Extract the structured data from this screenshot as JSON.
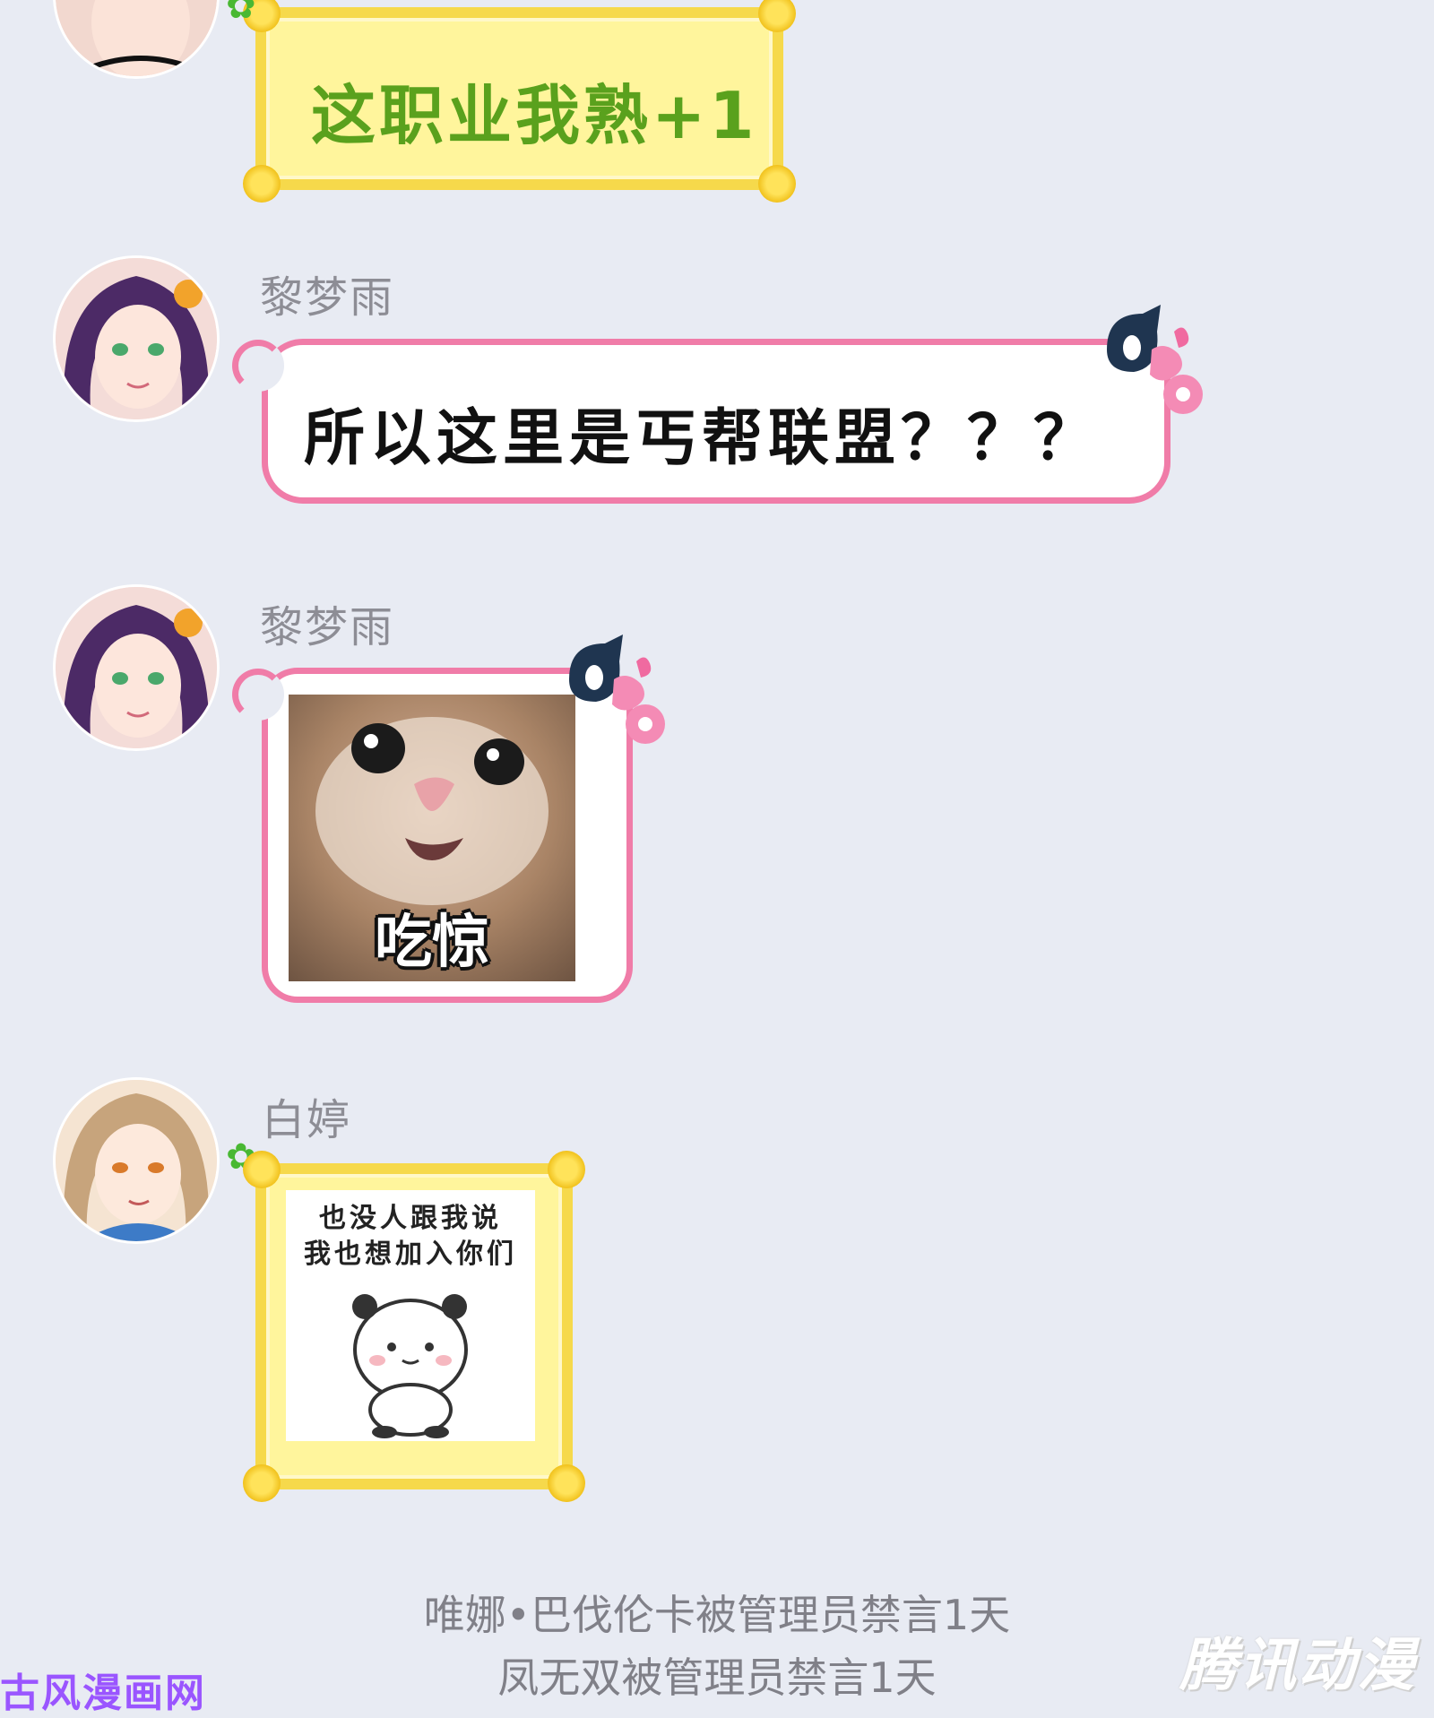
{
  "messages": [
    {
      "sender": "",
      "text": "这职业我熟+1"
    },
    {
      "sender": "黎梦雨",
      "text": "所以这里是丐帮联盟？？？"
    },
    {
      "sender": "黎梦雨",
      "sticker_caption": "吃惊"
    },
    {
      "sender": "白婷",
      "sticker_lines": [
        "也没人跟我说",
        "我也想加入你们"
      ]
    }
  ],
  "system_notices": [
    "唯娜•巴伐伦卡被管理员禁言1天",
    "凤无双被管理员禁言1天"
  ],
  "watermarks": {
    "left": "古风漫画网",
    "right": "腾讯动漫"
  },
  "colors": {
    "background": "#e8ebf3",
    "pink_border": "#f07ca8",
    "yellow_bubble": "#fff59c",
    "green_text": "#5aa11d"
  }
}
